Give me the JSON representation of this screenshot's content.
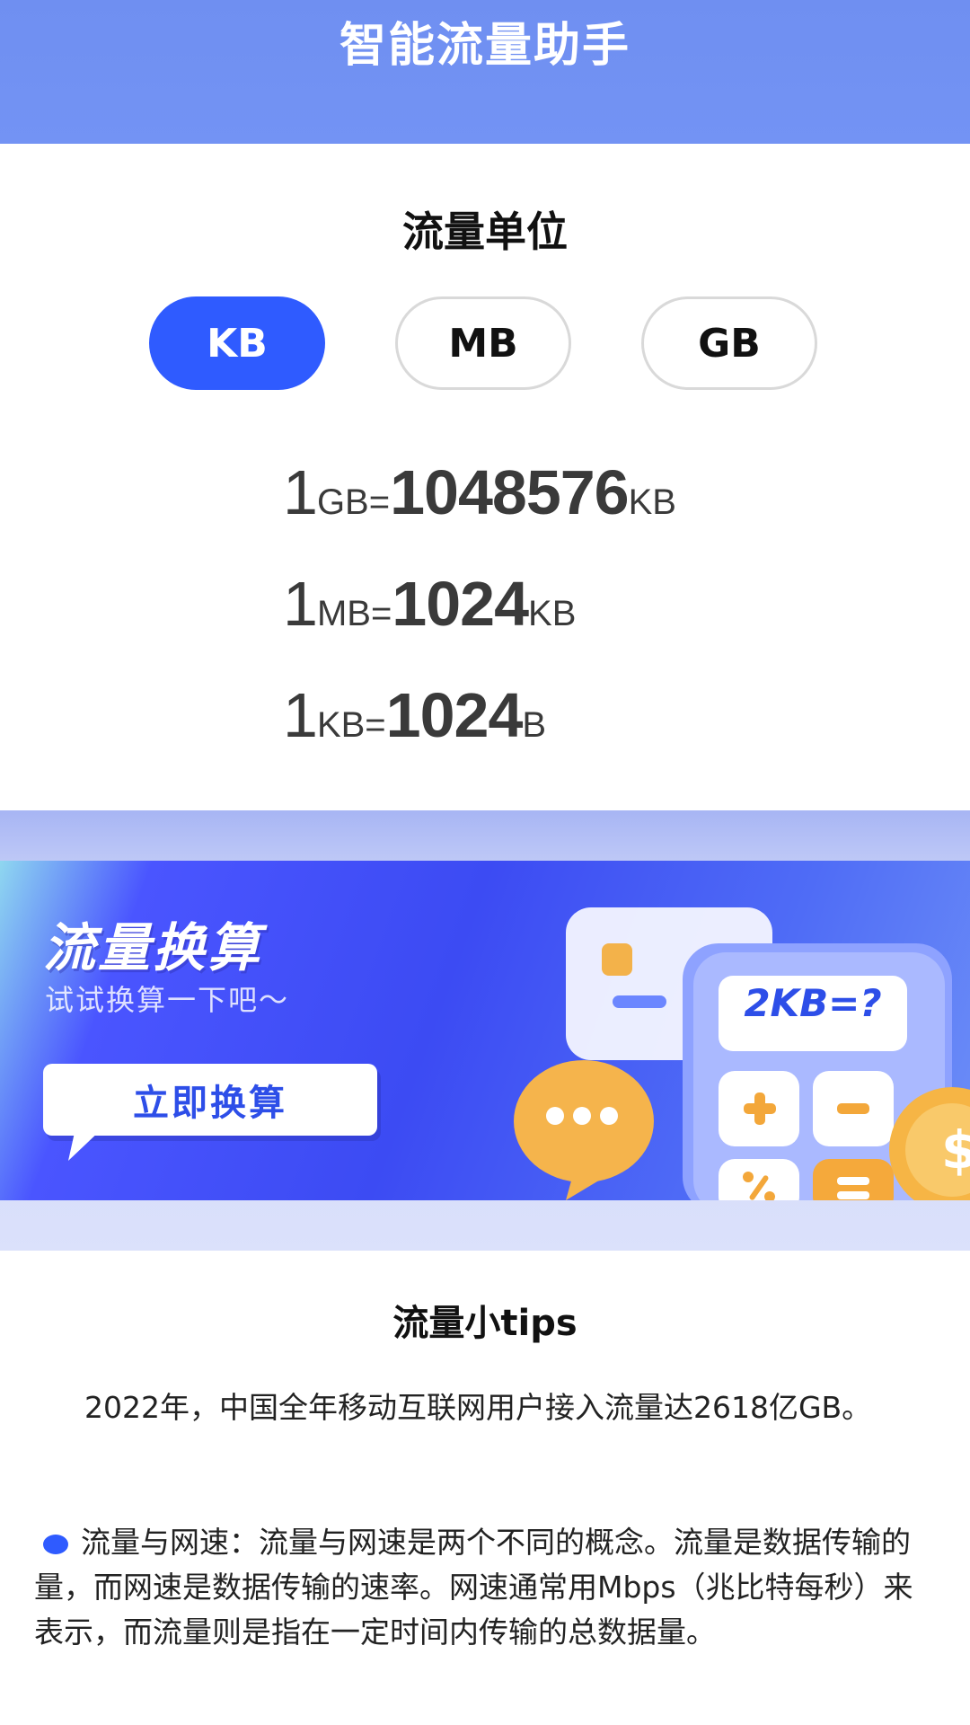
{
  "header": {
    "title": "智能流量助手"
  },
  "units": {
    "title": "流量单位",
    "options": [
      "KB",
      "MB",
      "GB"
    ],
    "selected": "KB",
    "conversions": [
      {
        "lhs_value": "1",
        "lhs_unit": "GB=",
        "rhs_value": "1048576",
        "rhs_unit": "KB"
      },
      {
        "lhs_value": "1",
        "lhs_unit": "MB=",
        "rhs_value": "1024",
        "rhs_unit": "KB"
      },
      {
        "lhs_value": "1",
        "lhs_unit": "KB=",
        "rhs_value": "1024",
        "rhs_unit": "B"
      }
    ]
  },
  "banner": {
    "title": "流量换算",
    "subtitle": "试试换算一下吧～",
    "cta_label": "立即换算",
    "calculator_display": "2KB=?"
  },
  "tips": {
    "title": "流量小tips",
    "paragraph1": "2022年，中国全年移动互联网用户接入流量达2618亿GB。",
    "bullet_label": "流量与网速：",
    "bullet_text": "流量与网速是两个不同的概念。流量是数据传输的量，而网速是数据传输的速率。网速通常用Mbps（兆比特每秒）来表示，而流量则是指在一定时间内传输的总数据量。"
  },
  "colors": {
    "header": "#7393f4",
    "accent": "#2f5bff",
    "banner": "#3c4bf3"
  }
}
